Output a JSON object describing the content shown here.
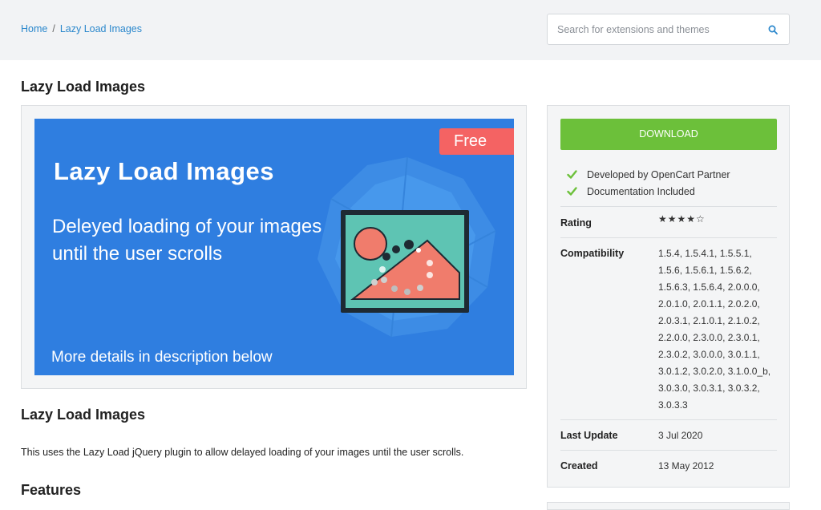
{
  "breadcrumb": {
    "home": "Home",
    "separator": "/",
    "current": "Lazy Load Images"
  },
  "search": {
    "placeholder": "Search for extensions and themes",
    "icon": "search-icon"
  },
  "page": {
    "title": "Lazy Load Images"
  },
  "banner": {
    "title": "Lazy Load Images",
    "subtitle": "Deleyed loading of your images until the user scrolls",
    "more": "More details in description below",
    "badge": "Free",
    "colors": {
      "background": "#2f7ee0",
      "badge": "#f46363",
      "frame_fill": "#5ec4b3",
      "mountain": "#f07c6c"
    }
  },
  "content": {
    "heading": "Lazy Load Images",
    "description": "This uses the Lazy Load jQuery plugin to allow delayed loading of your images until the user scrolls.",
    "features_heading": "Features"
  },
  "sidebar": {
    "download_label": "DOWNLOAD",
    "download_color": "#6cc03a",
    "checks": [
      "Developed by OpenCart Partner",
      "Documentation Included"
    ],
    "rating_label": "Rating",
    "rating": {
      "value": 4,
      "max": 5,
      "display": "★★★★☆"
    },
    "compatibility_label": "Compatibility",
    "compatibility": "1.5.4, 1.5.4.1, 1.5.5.1, 1.5.6, 1.5.6.1, 1.5.6.2, 1.5.6.3, 1.5.6.4, 2.0.0.0, 2.0.1.0, 2.0.1.1, 2.0.2.0, 2.0.3.1, 2.1.0.1, 2.1.0.2, 2.2.0.0, 2.3.0.0, 2.3.0.1, 2.3.0.2, 3.0.0.0, 3.0.1.1, 3.0.1.2, 3.0.2.0, 3.1.0.0_b, 3.0.3.0, 3.0.3.1, 3.0.3.2, 3.0.3.3",
    "last_update_label": "Last Update",
    "last_update": "3 Jul 2020",
    "created_label": "Created",
    "created": "13 May 2012"
  }
}
